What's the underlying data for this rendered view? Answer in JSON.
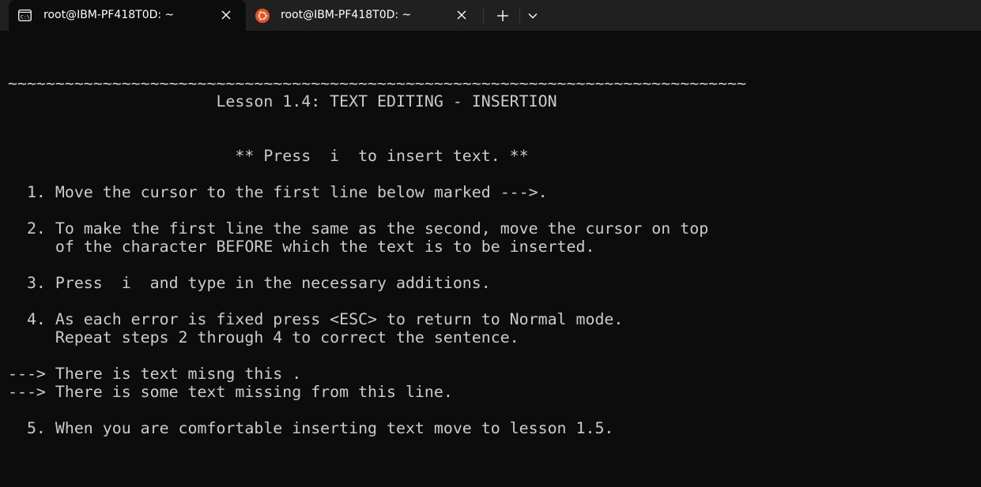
{
  "tabs": [
    {
      "title": "root@IBM-PF418T0D: ~",
      "icon": "terminal-icon",
      "active": true
    },
    {
      "title": "root@IBM-PF418T0D: ~",
      "icon": "ubuntu-icon",
      "active": false
    }
  ],
  "colors": {
    "background": "#0c0c0c",
    "tabbar": "#202020",
    "text": "#cccccc",
    "ubuntu_orange": "#e95420"
  },
  "terminal": {
    "lines": [
      "~~~~~~~~~~~~~~~~~~~~~~~~~~~~~~~~~~~~~~~~~~~~~~~~~~~~~~~~~~~~~~~~~~~~~~~~~~~~~~",
      "                      Lesson 1.4: TEXT EDITING - INSERTION",
      "",
      "",
      "                        ** Press  i  to insert text. **",
      "",
      "  1. Move the cursor to the first line below marked --->.",
      "",
      "  2. To make the first line the same as the second, move the cursor on top",
      "     of the character BEFORE which the text is to be inserted.",
      "",
      "  3. Press  i  and type in the necessary additions.",
      "",
      "  4. As each error is fixed press <ESC> to return to Normal mode.",
      "     Repeat steps 2 through 4 to correct the sentence.",
      "",
      "---> There is text misng this .",
      "---> There is some text missing from this line.",
      "",
      "  5. When you are comfortable inserting text move to lesson 1.5."
    ]
  }
}
